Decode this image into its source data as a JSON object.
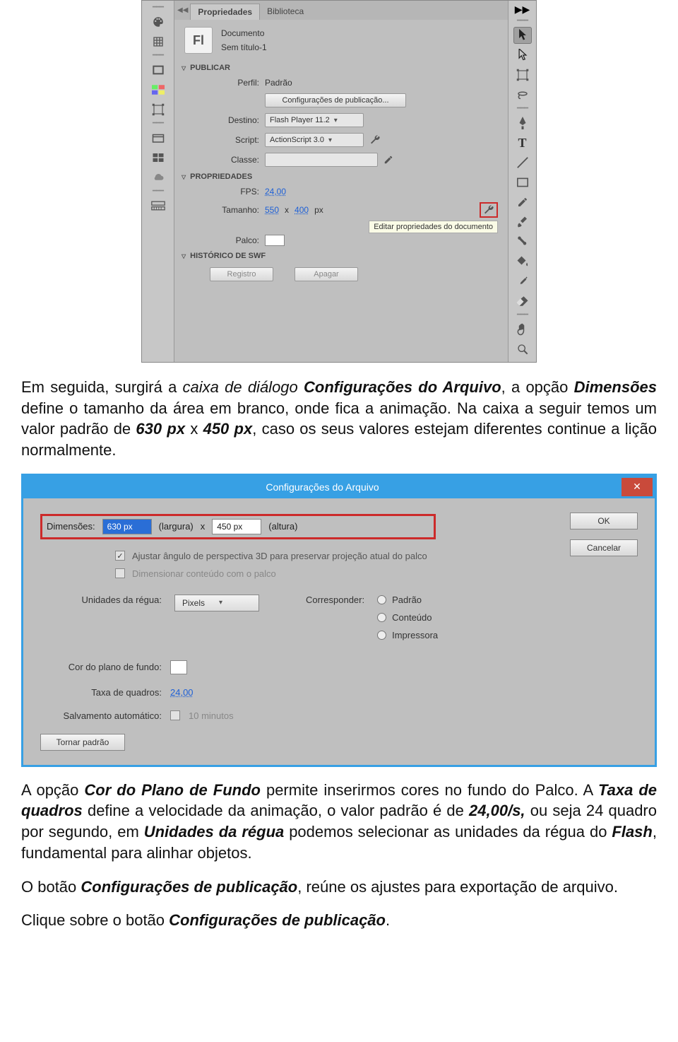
{
  "flash_panel": {
    "tabs": {
      "properties": "Propriedades",
      "library": "Biblioteca"
    },
    "doc": {
      "type": "Documento",
      "name": "Sem título-1"
    },
    "sections": {
      "publish": "PUBLICAR",
      "properties": "PROPRIEDADES",
      "swf_history": "HISTÓRICO DE SWF"
    },
    "publish": {
      "profile_label": "Perfil:",
      "profile_value": "Padrão",
      "pub_settings_button": "Configurações de publicação...",
      "destination_label": "Destino:",
      "destination_value": "Flash Player 11.2",
      "script_label": "Script:",
      "script_value": "ActionScript 3.0",
      "class_label": "Classe:",
      "class_value": ""
    },
    "props": {
      "fps_label": "FPS:",
      "fps_value": "24,00",
      "size_label": "Tamanho:",
      "size_w": "550",
      "size_x": "x",
      "size_h": "400",
      "size_unit": "px",
      "wrench_tooltip": "Editar propriedades do documento",
      "stage_label": "Palco:"
    },
    "history": {
      "log_button": "Registro",
      "clear_button": "Apagar"
    }
  },
  "paragraph1": {
    "t1": "Em seguida, surgirá a ",
    "t2": "caixa de diálogo",
    "t3": " ",
    "t4": "Configurações do Arquivo",
    "t5": ", a opção ",
    "t6": "Dimensões",
    "t7": " define o tamanho da área em branco, onde fica a animação. Na caixa a seguir temos um valor padrão de ",
    "t8": "630 px",
    "t9": " x ",
    "t10": "450 px",
    "t11": ", caso os seus valores estejam diferentes continue a lição normalmente."
  },
  "dialog": {
    "title": "Configurações do Arquivo",
    "close": "✕",
    "ok": "OK",
    "cancel": "Cancelar",
    "dim_label": "Dimensões:",
    "dim_w": "630 px",
    "dim_wcap": "(largura)",
    "dim_x": "x",
    "dim_h": "450 px",
    "dim_hcap": "(altura)",
    "adjust3d": "Ajustar ângulo de perspectiva 3D para preservar projeção atual do palco",
    "scale_content": "Dimensionar conteúdo com o palco",
    "ruler_label": "Unidades da régua:",
    "ruler_value": "Pixels",
    "match_label": "Corresponder:",
    "match_options": [
      "Padrão",
      "Conteúdo",
      "Impressora"
    ],
    "bgcolor_label": "Cor do plano de fundo:",
    "framerate_label": "Taxa de quadros:",
    "framerate_value": "24,00",
    "autosave_label": "Salvamento automático:",
    "autosave_value": "10 minutos",
    "make_default": "Tornar padrão"
  },
  "paragraph2": {
    "t1": "A opção ",
    "t2": "Cor do Plano de Fundo",
    "t3": " permite inserirmos cores no fundo do Palco. A ",
    "t4": "Taxa de quadros",
    "t5": " define a velocidade da animação, o valor padrão é de ",
    "t6": "24,00/s,",
    "t7": " ou seja 24 quadro por segundo, em ",
    "t8": "Unidades da régua",
    "t9": " podemos selecionar as unidades da régua do ",
    "t10": "Flash",
    "t11": ", fundamental para alinhar objetos."
  },
  "paragraph3": {
    "t1": "O botão ",
    "t2": "Configurações de publicação",
    "t3": ", reúne os ajustes para exportação de arquivo."
  },
  "paragraph4": {
    "t1": "Clique sobre o botão ",
    "t2": "Configurações de publicação",
    "t3": "."
  }
}
